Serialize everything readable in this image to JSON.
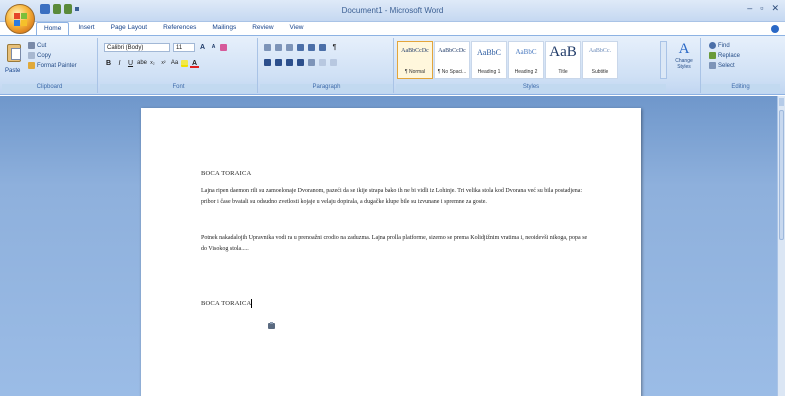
{
  "window": {
    "title": "Document1 - Microsoft Word",
    "controls": [
      "–",
      "▫",
      "✕"
    ]
  },
  "tabs": [
    "Home",
    "Insert",
    "Page Layout",
    "References",
    "Mailings",
    "Review",
    "View"
  ],
  "ribbon": {
    "clipboard": {
      "label": "Clipboard",
      "paste": "Paste",
      "cut": "Cut",
      "copy": "Copy",
      "format_painter": "Format Painter"
    },
    "font": {
      "label": "Font",
      "font_name": "Calibri (Body)",
      "font_size": "11"
    },
    "paragraph": {
      "label": "Paragraph"
    },
    "styles": {
      "label": "Styles",
      "tiles": [
        {
          "sample": "AaBbCcDc",
          "name": "¶ Normal"
        },
        {
          "sample": "AaBbCcDc",
          "name": "¶ No Spaci..."
        },
        {
          "sample": "AaBbC",
          "name": "Heading 1"
        },
        {
          "sample": "AaBbC",
          "name": "Heading 2"
        },
        {
          "sample": "AaB",
          "name": "Title"
        },
        {
          "sample": "AaBbCc.",
          "name": "Subtitle"
        }
      ],
      "change_styles": "Change Styles"
    },
    "editing": {
      "label": "Editing",
      "find": "Find",
      "replace": "Replace",
      "select": "Select"
    }
  },
  "document": {
    "heading": "BOCA TORAICA",
    "paragraph1": "Lajna ripen daemon rili su zamoelonaje Dvoranom, pazeći da se ikije strapa bako ih ne bi vidli iz Lohinje. Tri velika stola kod Dvorana već su bila postadjena: pribor i čase bvatali su odsudno zvetlosti kojaje u velaju dopirala, a dugačke klupe bile su izvunane i spremne za goste.",
    "paragraph2": "Potnek nakadalojih Upravnika vodi ra u prenoažni crodio na zaduzma. Lajna prolla platforme, sizemo se prema Kolidjižnim vratima i, neoidevši nikoga, popa se do Visokog stola.....",
    "heading2": "BOCA TORAICA"
  },
  "colors": {
    "ribbon_text": "#15428b",
    "doc_background": "#8eb0dc",
    "selected_style": "#e3a53b"
  }
}
